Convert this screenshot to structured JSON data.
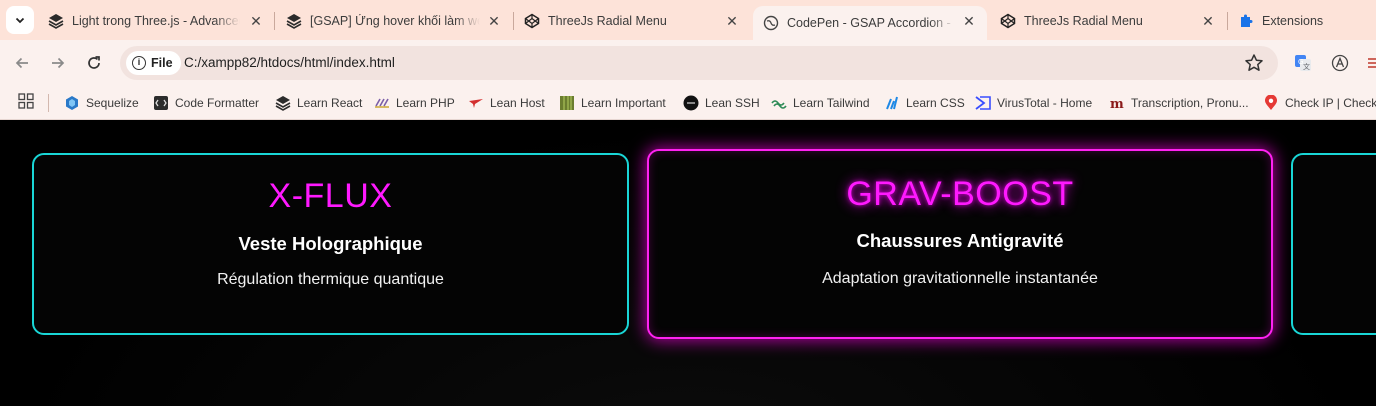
{
  "browser": {
    "tabs": [
      {
        "title": "Light trong Three.js - Advanced",
        "icon": "layers-icon"
      },
      {
        "title": "[GSAP] Ứng hover khối làm web",
        "icon": "layers-icon"
      },
      {
        "title": "ThreeJs Radial Menu",
        "icon": "codepen-icon"
      },
      {
        "title": "CodePen - GSAP Accordion - Ki",
        "icon": "globe-icon",
        "active": true
      },
      {
        "title": "ThreeJs Radial Menu",
        "icon": "codepen-icon"
      },
      {
        "title": "Extensions",
        "icon": "puzzle-icon"
      }
    ],
    "close_glyph": "✕",
    "site_chip": "File",
    "info_glyph": "i",
    "url": "C:/xampp82/htdocs/html/index.html",
    "bookmarks": [
      {
        "label": "Sequelize",
        "icon": "sequelize-icon"
      },
      {
        "label": "Code Formatter",
        "icon": "code-formatter-icon"
      },
      {
        "label": "Learn React",
        "icon": "layers-icon"
      },
      {
        "label": "Learn PHP",
        "icon": "php-icon"
      },
      {
        "label": "Lean Host",
        "icon": "plane-icon"
      },
      {
        "label": "Learn Important",
        "icon": "bamboo-icon"
      },
      {
        "label": "Lean SSH",
        "icon": "ssh-icon"
      },
      {
        "label": "Learn Tailwind",
        "icon": "tailwind-icon"
      },
      {
        "label": "Learn CSS",
        "icon": "css-icon"
      },
      {
        "label": "VirusTotal - Home",
        "icon": "virustotal-icon"
      },
      {
        "label": "Transcription, Pronu...",
        "icon": "m-icon"
      },
      {
        "label": "Check IP | Check",
        "icon": "location-pin-icon"
      }
    ],
    "colors": {
      "tabstrip": "#fde3d9",
      "toolbar": "#fbf1ee"
    }
  },
  "page": {
    "cards": [
      {
        "brand": "X-FLUX",
        "product": "Veste Holographique",
        "description": "Régulation thermique quantique",
        "border_color": "#19d6d6"
      },
      {
        "brand": "GRAV-BOOST",
        "product": "Chaussures Antigravité",
        "description": "Adaptation gravitationnelle instantanée",
        "border_color": "#ff22f2",
        "active": true
      },
      {
        "brand": "",
        "product": "",
        "description": "",
        "border_color": "#19d6d6"
      }
    ],
    "colors": {
      "background": "#000000",
      "brand_text": "#ff19ff",
      "cyan": "#19d6d6",
      "magenta": "#ff22f2"
    }
  }
}
